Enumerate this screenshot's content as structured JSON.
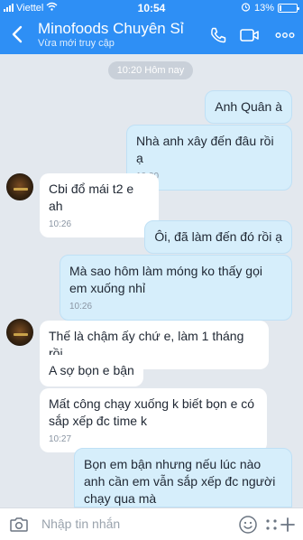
{
  "status_bar": {
    "carrier": "Viettel",
    "time": "10:54",
    "battery_percent": "13%",
    "battery_level": 0.13,
    "icons": [
      "signal-icon",
      "wifi-icon",
      "alarm-icon",
      "battery-icon"
    ]
  },
  "header": {
    "title": "Minofoods Chuyên Sỉ",
    "subtitle": "Vừa mới truy cập",
    "icons": [
      "back-arrow-icon",
      "phone-icon",
      "video-camera-icon",
      "more-icon"
    ]
  },
  "chat": {
    "time_divider": "10:20 Hôm nay",
    "messages": [
      {
        "dir": "out",
        "text": "Anh Quân à",
        "time": ""
      },
      {
        "dir": "out",
        "text": "Nhà anh xây đến đâu rồi ạ",
        "time": "10:20"
      },
      {
        "dir": "in",
        "text": "Cbi đổ mái t2 e ah",
        "time": "10:26"
      },
      {
        "dir": "out",
        "text": "Ôi, đã làm đến đó rồi ạ",
        "time": ""
      },
      {
        "dir": "out",
        "text": "Mà sao hôm làm móng ko thấy gọi em xuống nhỉ",
        "time": "10:26"
      },
      {
        "dir": "in",
        "text": "Thế là chậm ấy chứ e, làm 1 tháng rồi",
        "time": ""
      },
      {
        "dir": "in",
        "text": "A sợ bọn e bận",
        "time": ""
      },
      {
        "dir": "in",
        "text": "Mất công chạy xuống k biết bọn e có sắp xếp đc time k",
        "time": "10:27"
      },
      {
        "dir": "out",
        "text": "Bọn em bận nhưng nếu lúc nào anh cần em vẫn sắp xếp đc người chạy qua mà",
        "time": ""
      }
    ]
  },
  "input_bar": {
    "placeholder": "Nhập tin nhắn",
    "icons": [
      "camera-icon",
      "emoji-icon",
      "more-options-icon",
      "add-icon"
    ]
  },
  "colors": {
    "header_blue": "#2e8ff5",
    "outgoing_bubble": "#d6eefb",
    "incoming_bubble": "#ffffff",
    "chat_background": "#e3e8ee"
  }
}
